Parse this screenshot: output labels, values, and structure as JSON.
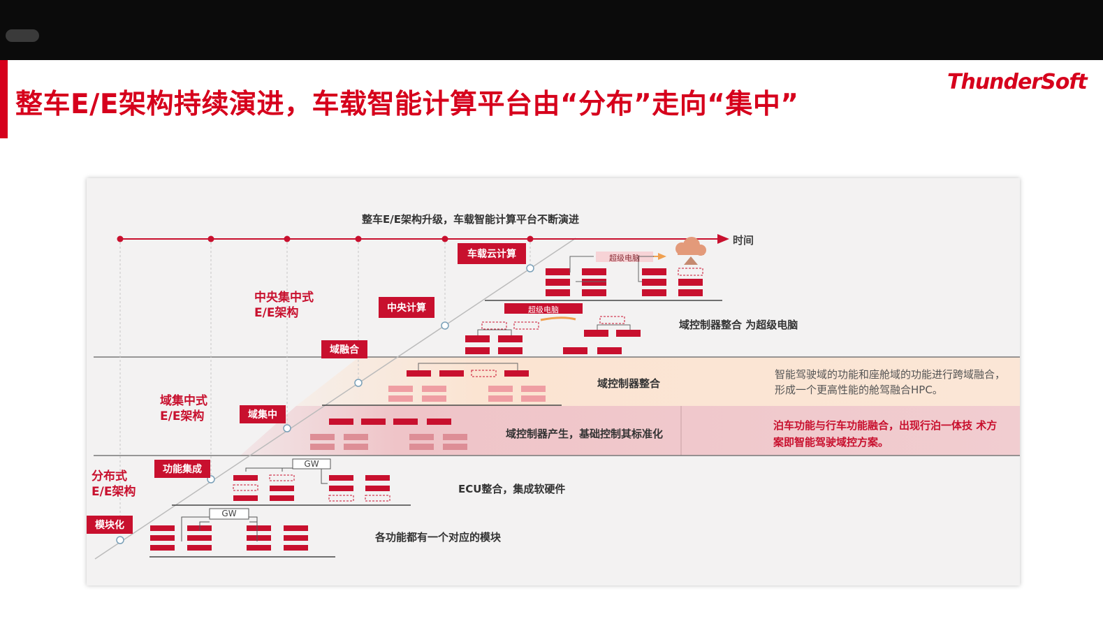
{
  "slide": {
    "title": "整车E/E架构持续演进，车载智能计算平台由“分布”走向“集中”",
    "logo_text": "ThunderSoft",
    "brand_color": "#d6001c"
  },
  "diagram": {
    "heading": "整车E/E架构升级，车载智能计算平台不断演进",
    "axis_label": "时间",
    "architectures": [
      {
        "label_line1": "分布式",
        "label_line2": "E/E架构"
      },
      {
        "label_line1": "域集中式",
        "label_line2": "E/E架构"
      },
      {
        "label_line1": "中央集中式",
        "label_line2": "E/E架构"
      }
    ],
    "stages": [
      "模块化",
      "功能集成",
      "域集中",
      "域融合",
      "中央计算",
      "车载云计算"
    ],
    "stage_notes": {
      "modular": "各功能都有一个对应的模块",
      "function_integration": "ECU整合，集成软硬件",
      "domain_centralized": "域控制器产生，基础控制其标准化",
      "domain_fusion": "域控制器整合",
      "central_compute": "域控制器整合 为超级电脑"
    },
    "gateway_label": "GW",
    "super_computer_label": "超级电脑",
    "fusion_description": "智能驾驶域的功能和座舱域的功能进行跨域融合，形成一个更高性能的舱驾融合HPC。",
    "domain_description": "泊车功能与行车功能融合，出现行泊一体技 术方案即智能驾驶域控方案。"
  }
}
